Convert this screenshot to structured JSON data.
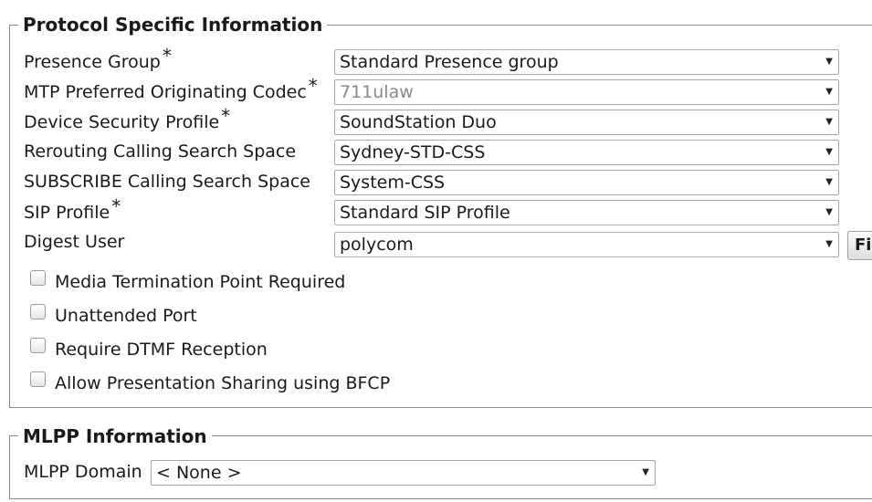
{
  "protocol_section": {
    "title": "Protocol Specific Information",
    "fields": [
      {
        "label": "Presence Group",
        "required": "*",
        "value": "Standard Presence group"
      },
      {
        "label": "MTP Preferred Originating Codec",
        "required": "*",
        "value": "711ulaw"
      },
      {
        "label": "Device Security Profile",
        "required": "*",
        "value": "SoundStation Duo"
      },
      {
        "label": "Rerouting Calling Search Space",
        "required": "",
        "value": "Sydney-STD-CSS"
      },
      {
        "label": "SUBSCRIBE Calling Search Space",
        "required": "",
        "value": "System-CSS"
      },
      {
        "label": "SIP Profile",
        "required": "*",
        "value": "Standard SIP Profile"
      },
      {
        "label": "Digest User",
        "required": "",
        "value": "polycom"
      }
    ],
    "find_button": "Fi",
    "checkboxes": [
      {
        "label": "Media Termination Point Required",
        "checked": false
      },
      {
        "label": "Unattended Port",
        "checked": false
      },
      {
        "label": "Require DTMF Reception",
        "checked": false
      },
      {
        "label": "Allow Presentation Sharing using BFCP",
        "checked": false
      }
    ]
  },
  "mlpp_section": {
    "title": "MLPP Information",
    "domain_label": "MLPP Domain",
    "domain_value": "< None >"
  },
  "icons": {
    "dropdown_arrow": "▼"
  }
}
